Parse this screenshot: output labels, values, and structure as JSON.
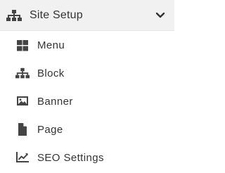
{
  "section": {
    "title": "Site Setup",
    "icon": "sitemap-icon",
    "expand_icon": "chevron-down-icon"
  },
  "items": [
    {
      "label": "Menu",
      "icon": "grid-icon"
    },
    {
      "label": "Block",
      "icon": "sitemap-icon"
    },
    {
      "label": "Banner",
      "icon": "image-icon"
    },
    {
      "label": "Page",
      "icon": "file-icon"
    },
    {
      "label": "SEO Settings",
      "icon": "chart-line-icon"
    }
  ],
  "colors": {
    "header_bg": "#f1f1f1",
    "text": "#333333",
    "icon": "#444444"
  }
}
